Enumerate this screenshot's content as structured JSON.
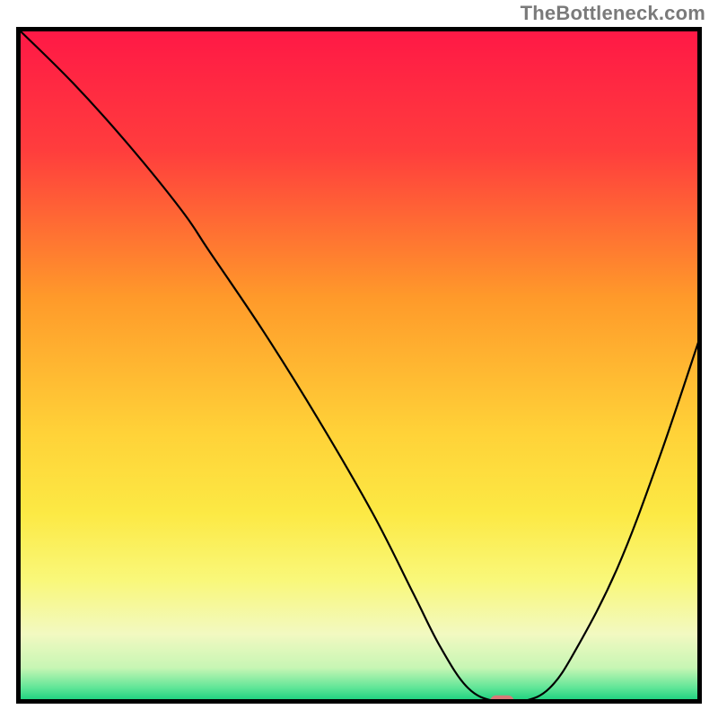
{
  "watermark": "TheBottleneck.com",
  "chart_data": {
    "type": "line",
    "title": "",
    "xlabel": "",
    "ylabel": "",
    "xlim": [
      0,
      100
    ],
    "ylim": [
      0,
      100
    ],
    "grid": false,
    "legend": false,
    "background": {
      "type": "vertical-gradient",
      "stops": [
        {
          "y": 0,
          "color": "#ff1846"
        },
        {
          "y": 18,
          "color": "#ff3d3d"
        },
        {
          "y": 40,
          "color": "#ff9a2a"
        },
        {
          "y": 60,
          "color": "#ffd238"
        },
        {
          "y": 72,
          "color": "#fce944"
        },
        {
          "y": 82,
          "color": "#f9f87a"
        },
        {
          "y": 90,
          "color": "#f2f9c1"
        },
        {
          "y": 95,
          "color": "#c7f6b4"
        },
        {
          "y": 98,
          "color": "#5fe597"
        },
        {
          "y": 100,
          "color": "#16d07d"
        }
      ]
    },
    "series": [
      {
        "name": "bottleneck-curve",
        "color": "#000000",
        "x": [
          0,
          8,
          16,
          24,
          28,
          36,
          44,
          52,
          58,
          62,
          66,
          70,
          74,
          78,
          82,
          88,
          94,
          100
        ],
        "y": [
          100,
          92,
          83,
          73,
          67,
          55,
          42,
          28,
          16,
          8,
          2,
          0,
          0,
          2,
          8,
          20,
          36,
          54
        ]
      }
    ],
    "marker": {
      "name": "optimal-point",
      "x": 71,
      "y": 0,
      "color": "#d87a78",
      "shape": "rounded-rect",
      "w": 3.5,
      "h": 1.8
    },
    "frame_color": "#000000",
    "frame_width": 5
  }
}
